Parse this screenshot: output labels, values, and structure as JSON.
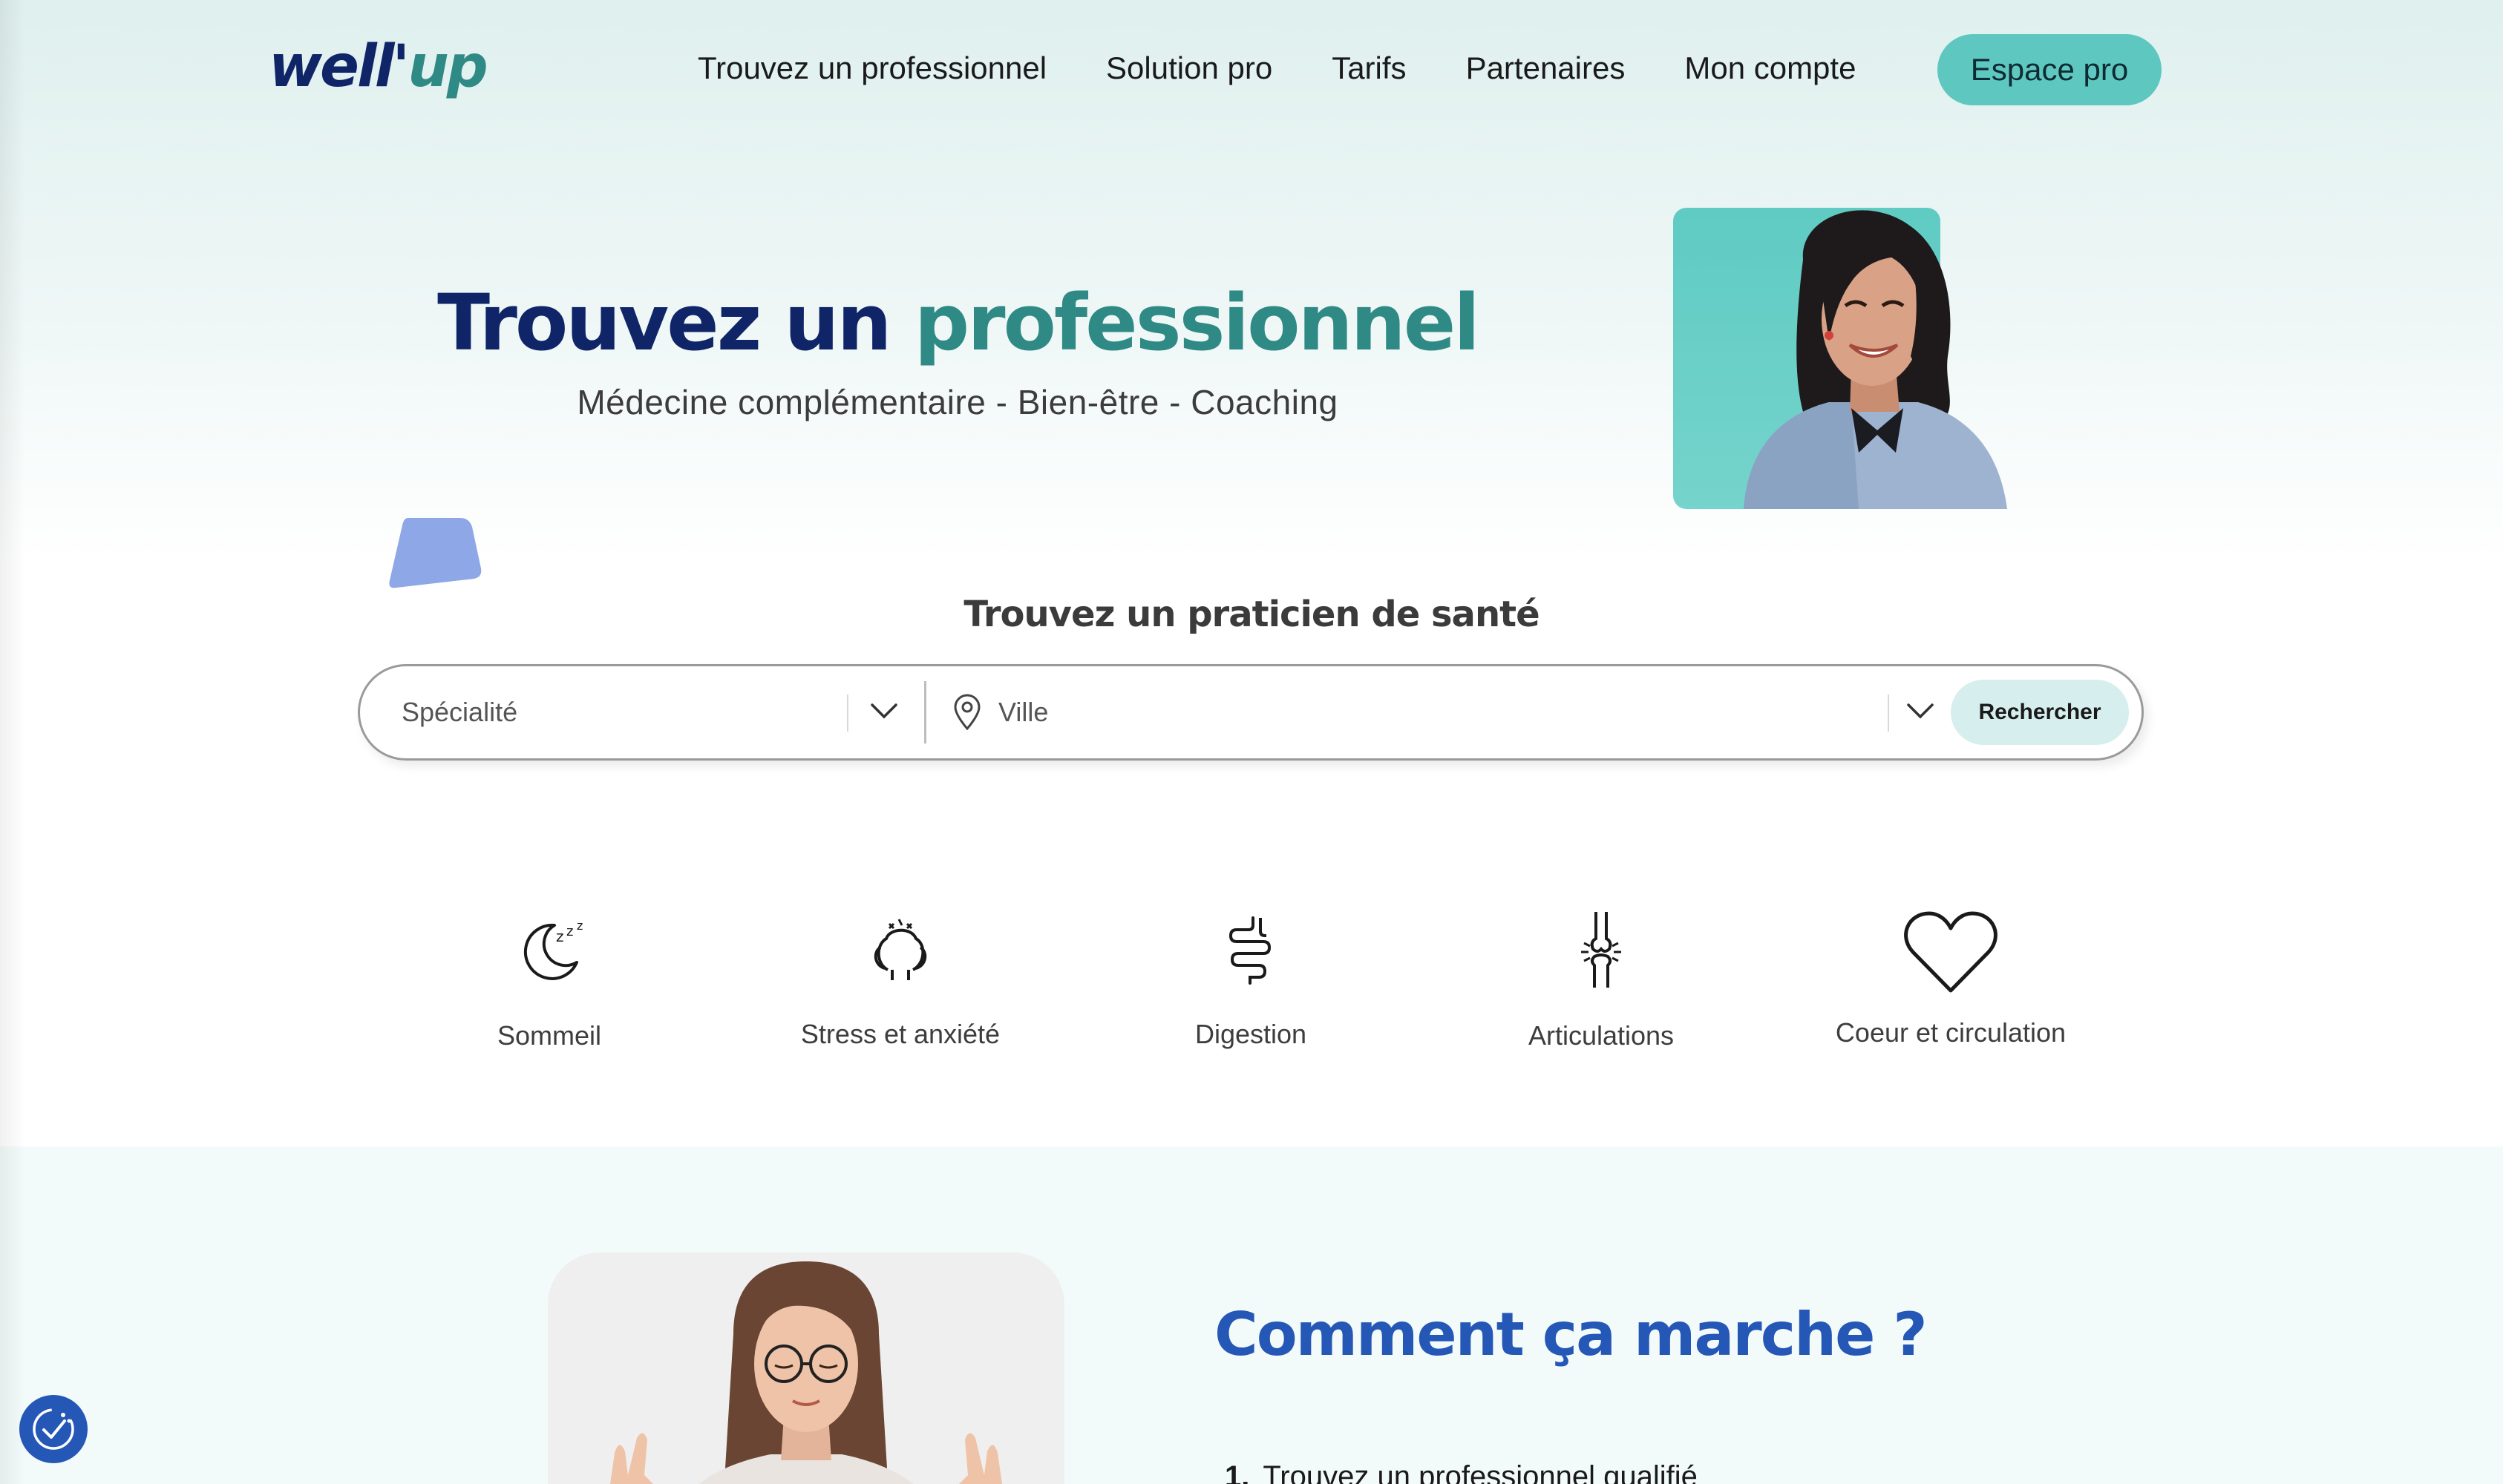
{
  "header": {
    "logo_main": "well'",
    "logo_accent": "up",
    "nav": [
      "Trouvez un professionnel",
      "Solution pro",
      "Tarifs",
      "Partenaires",
      "Mon compte"
    ],
    "cta": "Espace pro"
  },
  "hero": {
    "title_part1": "Trouvez un ",
    "title_part2": "professionnel",
    "subtitle": "Médecine complémentaire - Bien-être - Coaching"
  },
  "search": {
    "title": "Trouvez un praticien de santé",
    "specialite_placeholder": "Spécialité",
    "ville_placeholder": "Ville",
    "button": "Rechercher"
  },
  "categories": [
    {
      "label": "Sommeil",
      "icon": "moon-sleep-icon"
    },
    {
      "label": "Stress et anxiété",
      "icon": "stress-head-icon"
    },
    {
      "label": "Digestion",
      "icon": "intestine-icon"
    },
    {
      "label": "Articulations",
      "icon": "joint-icon"
    },
    {
      "label": "Coeur et circulation",
      "icon": "heart-icon"
    }
  ],
  "how": {
    "title": "Comment ça marche ?",
    "step1_num": "1.",
    "step1_text": "Trouvez un professionnel qualifié"
  },
  "colors": {
    "brand_navy": "#0f2567",
    "brand_teal": "#2f8a86",
    "cta_bg": "#5ec8c0",
    "section_title_blue": "#2557b6"
  }
}
